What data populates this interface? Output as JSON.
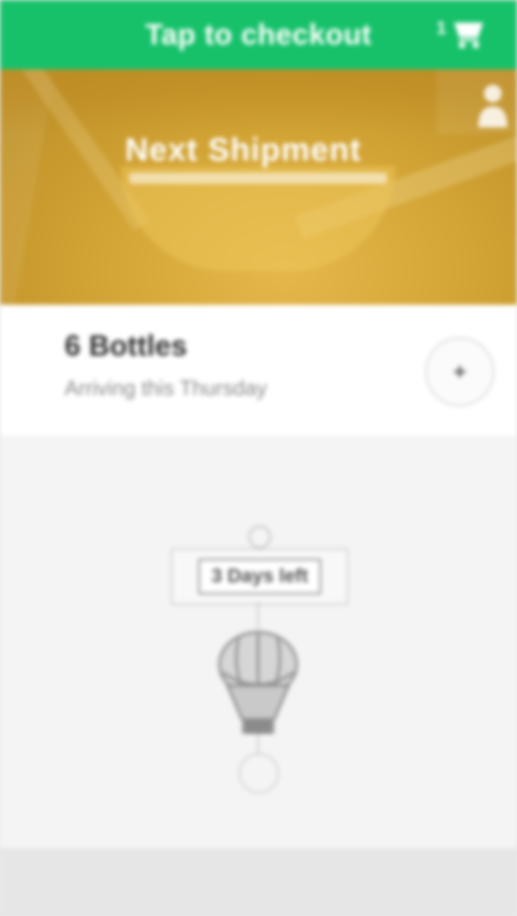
{
  "checkout": {
    "label": "Tap to checkout",
    "cart_count": "1"
  },
  "hero": {
    "title": "Next Shipment"
  },
  "order": {
    "title": "6 Bottles",
    "subtitle": "Arriving this Thursday",
    "add_label": "+"
  },
  "timeline": {
    "days_label": "3 Days left"
  },
  "icons": {
    "cart": "shopping-cart-icon",
    "person": "person-icon",
    "balloon": "hot-air-balloon-icon"
  },
  "colors": {
    "accent_green": "#16c16a",
    "hero_gold": "#d3a536",
    "timeline_bg": "#f4f4f4"
  }
}
